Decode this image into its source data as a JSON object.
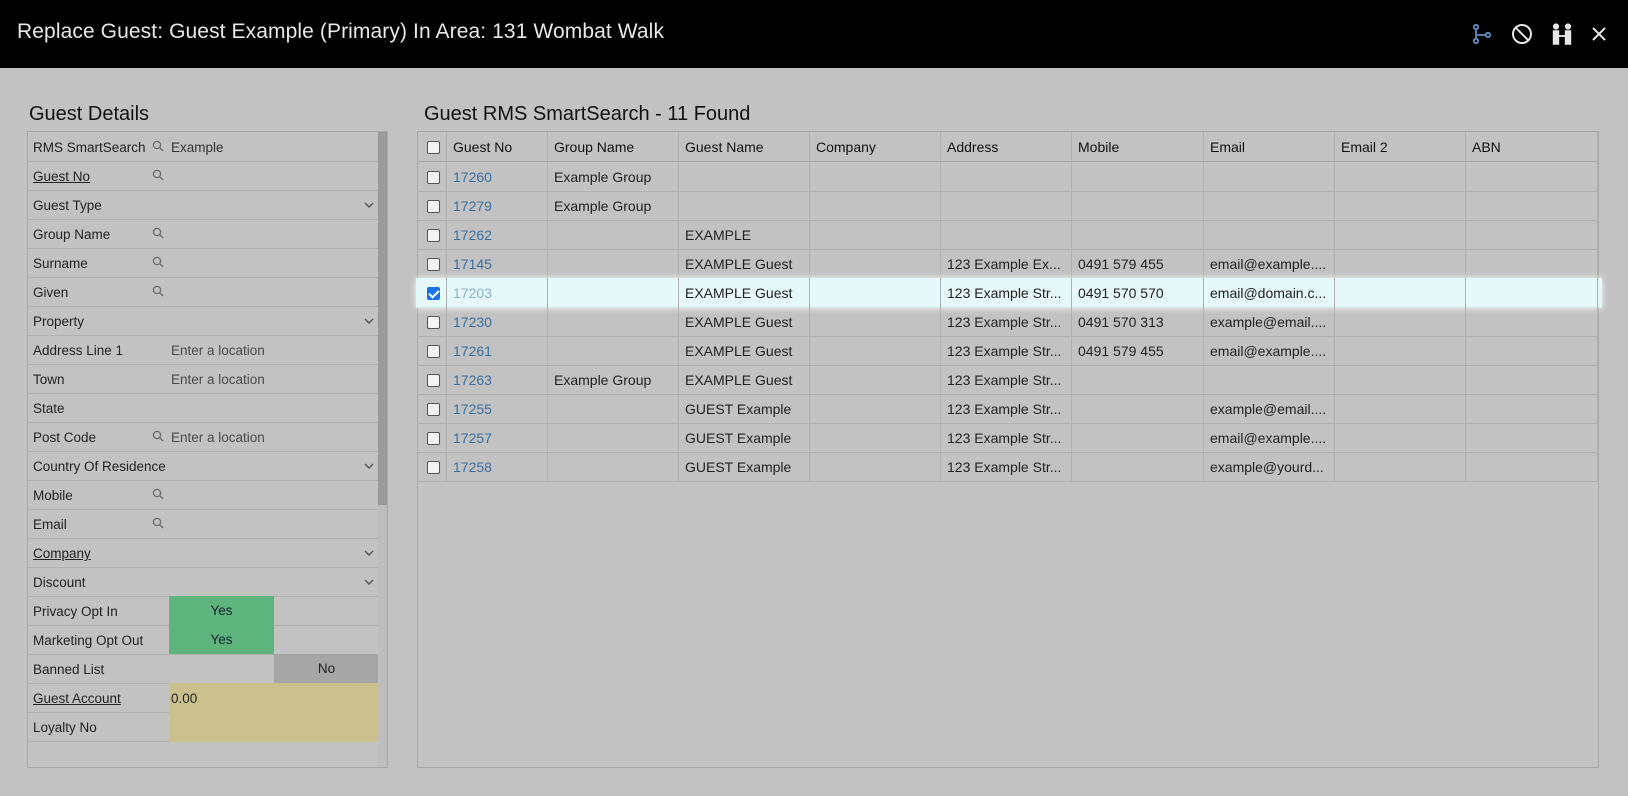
{
  "window": {
    "title": "Replace Guest: Guest Example (Primary) In Area: 131 Wombat Walk",
    "icons": [
      "merge-icon",
      "cancel-icon",
      "guests-icon",
      "close-icon"
    ]
  },
  "guest_details": {
    "heading": "Guest Details",
    "fields": [
      {
        "label": "RMS SmartSearch",
        "value": "Example",
        "search": true
      },
      {
        "label": "Guest No",
        "link": true,
        "search": true
      },
      {
        "label": "Guest Type",
        "dropdown": true
      },
      {
        "label": "Group Name",
        "search": true
      },
      {
        "label": "Surname",
        "search": true
      },
      {
        "label": "Given",
        "search": true
      },
      {
        "label": "Property",
        "dropdown": true
      },
      {
        "label": "Address Line 1",
        "placeholder": "Enter a location"
      },
      {
        "label": "Town",
        "placeholder": "Enter a location"
      },
      {
        "label": "State"
      },
      {
        "label": "Post Code",
        "placeholder": "Enter a location",
        "search": true
      },
      {
        "label": "Country Of Residence",
        "dropdown": true
      },
      {
        "label": "Mobile",
        "search": true
      },
      {
        "label": "Email",
        "search": true
      },
      {
        "label": "Company",
        "link": true,
        "dropdown": true
      },
      {
        "label": "Discount",
        "dropdown": true
      },
      {
        "label": "Privacy Opt In",
        "toggle": "Yes"
      },
      {
        "label": "Marketing Opt Out",
        "toggle": "Yes"
      },
      {
        "label": "Banned List",
        "toggle": "No"
      },
      {
        "label": "Guest Account",
        "link": true,
        "value": "0.00",
        "khaki": true
      },
      {
        "label": "Loyalty No",
        "khaki": true
      }
    ]
  },
  "results": {
    "heading": "Guest RMS SmartSearch - 11 Found",
    "columns": [
      "Guest No",
      "Group Name",
      "Guest Name",
      "Company",
      "Address",
      "Mobile",
      "Email",
      "Email 2",
      "ABN"
    ],
    "rows": [
      {
        "guest_no": "17260",
        "group": "Example Group",
        "name": "",
        "company": "",
        "address": "",
        "mobile": "",
        "email": "",
        "email2": "",
        "abn": "",
        "checked": false
      },
      {
        "guest_no": "17279",
        "group": "Example Group",
        "name": "",
        "company": "",
        "address": "",
        "mobile": "",
        "email": "",
        "email2": "",
        "abn": "",
        "checked": false
      },
      {
        "guest_no": "17262",
        "group": "",
        "name": "EXAMPLE",
        "company": "",
        "address": "",
        "mobile": "",
        "email": "",
        "email2": "",
        "abn": "",
        "checked": false
      },
      {
        "guest_no": "17145",
        "group": "",
        "name": "EXAMPLE Guest",
        "company": "",
        "address": "123 Example Ex...",
        "mobile": "0491 579 455",
        "email": "email@example....",
        "email2": "",
        "abn": "",
        "checked": false
      },
      {
        "guest_no": "17203",
        "group": "",
        "name": "EXAMPLE Guest",
        "company": "",
        "address": "123 Example Str...",
        "mobile": "0491 570 570",
        "email": "email@domain.c...",
        "email2": "",
        "abn": "",
        "checked": true
      },
      {
        "guest_no": "17230",
        "group": "",
        "name": "EXAMPLE Guest",
        "company": "",
        "address": "123 Example Str...",
        "mobile": "0491 570 313",
        "email": "example@email....",
        "email2": "",
        "abn": "",
        "checked": false
      },
      {
        "guest_no": "17261",
        "group": "",
        "name": "EXAMPLE Guest",
        "company": "",
        "address": "123 Example Str...",
        "mobile": "0491 579 455",
        "email": "email@example....",
        "email2": "",
        "abn": "",
        "checked": false
      },
      {
        "guest_no": "17263",
        "group": "Example Group",
        "name": "EXAMPLE Guest",
        "company": "",
        "address": "123 Example Str...",
        "mobile": "",
        "email": "",
        "email2": "",
        "abn": "",
        "checked": false
      },
      {
        "guest_no": "17255",
        "group": "",
        "name": "GUEST Example",
        "company": "",
        "address": "123 Example Str...",
        "mobile": "",
        "email": "example@email....",
        "email2": "",
        "abn": "",
        "checked": false
      },
      {
        "guest_no": "17257",
        "group": "",
        "name": "GUEST Example",
        "company": "",
        "address": "123 Example Str...",
        "mobile": "",
        "email": "email@example....",
        "email2": "",
        "abn": "",
        "checked": false
      },
      {
        "guest_no": "17258",
        "group": "",
        "name": "GUEST Example",
        "company": "",
        "address": "123 Example Str...",
        "mobile": "",
        "email": "example@yourd...",
        "email2": "",
        "abn": "",
        "checked": false
      }
    ]
  },
  "colors": {
    "titlebar": "#000000",
    "background": "#c2c2c2",
    "toggle_yes": "#5db47c",
    "toggle_no": "#a6a6a6",
    "account_field": "#c9c08c",
    "link": "#3a6fa0",
    "selected_row": "#e5f8fa"
  }
}
